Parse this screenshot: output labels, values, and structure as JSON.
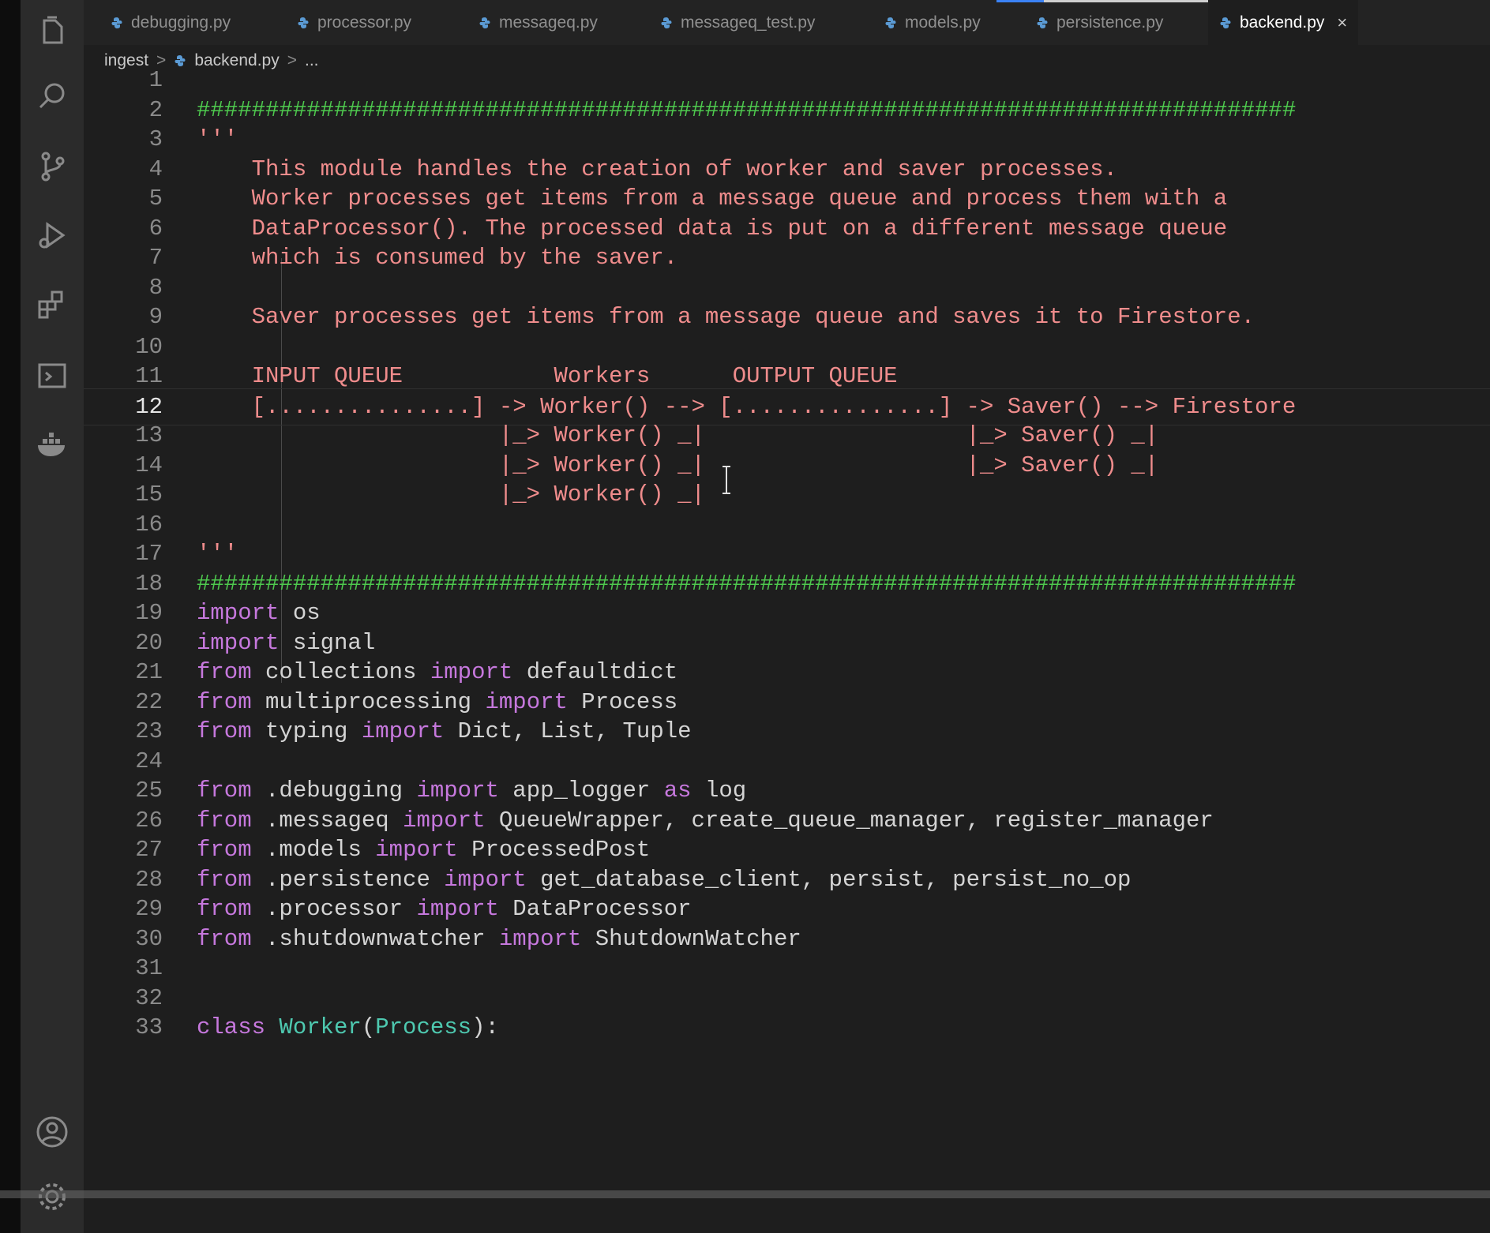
{
  "tabs": [
    {
      "label": "debugging.py",
      "active": false
    },
    {
      "label": "processor.py",
      "active": false
    },
    {
      "label": "messageq.py",
      "active": false
    },
    {
      "label": "messageq_test.py",
      "active": false
    },
    {
      "label": "models.py",
      "active": false
    },
    {
      "label": "persistence.py",
      "active": false
    },
    {
      "label": "backend.py",
      "active": true
    }
  ],
  "tab_close_glyph": "×",
  "breadcrumb": {
    "folder": "ingest",
    "file": "backend.py",
    "more": "...",
    "sep": ">"
  },
  "activity_icons": [
    "explorer-icon",
    "search-icon",
    "source-control-icon",
    "run-debug-icon",
    "extensions-icon",
    "remote-explorer-icon",
    "docker-icon",
    "account-icon",
    "settings-gear-icon"
  ],
  "colors": {
    "keyword": "#c678dd",
    "docstring": "#ef8c8c",
    "comment": "#4ec94e",
    "text": "#d4d4d4"
  },
  "current_line": 12,
  "lines": [
    {
      "n": "1",
      "tokens": []
    },
    {
      "n": "2",
      "tokens": [
        {
          "t": "################################################################################",
          "c": "hash"
        }
      ]
    },
    {
      "n": "3",
      "tokens": [
        {
          "t": "'''",
          "c": "doc"
        }
      ]
    },
    {
      "n": "4",
      "tokens": [
        {
          "t": "    This module handles the creation of worker and saver processes.",
          "c": "doc"
        }
      ]
    },
    {
      "n": "5",
      "tokens": [
        {
          "t": "    Worker processes get items from a message queue and process them with a",
          "c": "doc"
        }
      ]
    },
    {
      "n": "6",
      "tokens": [
        {
          "t": "    DataProcessor(). The processed data is put on a different message queue",
          "c": "doc"
        }
      ]
    },
    {
      "n": "7",
      "tokens": [
        {
          "t": "    which is consumed by the saver.",
          "c": "doc"
        }
      ]
    },
    {
      "n": "8",
      "tokens": []
    },
    {
      "n": "9",
      "tokens": [
        {
          "t": "    Saver processes get items from a message queue and saves it to Firestore.",
          "c": "doc"
        }
      ]
    },
    {
      "n": "10",
      "tokens": []
    },
    {
      "n": "11",
      "tokens": [
        {
          "t": "    INPUT QUEUE           Workers      OUTPUT QUEUE",
          "c": "doc"
        }
      ]
    },
    {
      "n": "12",
      "tokens": [
        {
          "t": "    [...............] -> Worker() --> [...............] -> Saver() --> Firestore",
          "c": "doc"
        }
      ]
    },
    {
      "n": "13",
      "tokens": [
        {
          "t": "                      |_> Worker() _|                   |_> Saver() _|",
          "c": "doc"
        }
      ]
    },
    {
      "n": "14",
      "tokens": [
        {
          "t": "                      |_> Worker() _|                   |_> Saver() _|",
          "c": "doc"
        }
      ]
    },
    {
      "n": "15",
      "tokens": [
        {
          "t": "                      |_> Worker() _|",
          "c": "doc"
        }
      ]
    },
    {
      "n": "16",
      "tokens": []
    },
    {
      "n": "17",
      "tokens": [
        {
          "t": "'''",
          "c": "doc"
        }
      ]
    },
    {
      "n": "18",
      "tokens": [
        {
          "t": "################################################################################",
          "c": "hash"
        }
      ]
    },
    {
      "n": "19",
      "tokens": [
        {
          "t": "import",
          "c": "kw"
        },
        {
          "t": " os",
          "c": "id"
        }
      ]
    },
    {
      "n": "20",
      "tokens": [
        {
          "t": "import",
          "c": "kw"
        },
        {
          "t": " signal",
          "c": "id"
        }
      ]
    },
    {
      "n": "21",
      "tokens": [
        {
          "t": "from",
          "c": "kw"
        },
        {
          "t": " collections ",
          "c": "id"
        },
        {
          "t": "import",
          "c": "kw"
        },
        {
          "t": " defaultdict",
          "c": "id"
        }
      ]
    },
    {
      "n": "22",
      "tokens": [
        {
          "t": "from",
          "c": "kw"
        },
        {
          "t": " multiprocessing ",
          "c": "id"
        },
        {
          "t": "import",
          "c": "kw"
        },
        {
          "t": " Process",
          "c": "id"
        }
      ]
    },
    {
      "n": "23",
      "tokens": [
        {
          "t": "from",
          "c": "kw"
        },
        {
          "t": " typing ",
          "c": "id"
        },
        {
          "t": "import",
          "c": "kw"
        },
        {
          "t": " Dict, List, Tuple",
          "c": "id"
        }
      ]
    },
    {
      "n": "24",
      "tokens": []
    },
    {
      "n": "25",
      "tokens": [
        {
          "t": "from",
          "c": "kw"
        },
        {
          "t": " .debugging ",
          "c": "id"
        },
        {
          "t": "import",
          "c": "kw"
        },
        {
          "t": " app_logger ",
          "c": "id"
        },
        {
          "t": "as",
          "c": "kw"
        },
        {
          "t": " log",
          "c": "id"
        }
      ]
    },
    {
      "n": "26",
      "tokens": [
        {
          "t": "from",
          "c": "kw"
        },
        {
          "t": " .messageq ",
          "c": "id"
        },
        {
          "t": "import",
          "c": "kw"
        },
        {
          "t": " QueueWrapper, create_queue_manager, register_manager",
          "c": "id"
        }
      ]
    },
    {
      "n": "27",
      "tokens": [
        {
          "t": "from",
          "c": "kw"
        },
        {
          "t": " .models ",
          "c": "id"
        },
        {
          "t": "import",
          "c": "kw"
        },
        {
          "t": " ProcessedPost",
          "c": "id"
        }
      ]
    },
    {
      "n": "28",
      "tokens": [
        {
          "t": "from",
          "c": "kw"
        },
        {
          "t": " .persistence ",
          "c": "id"
        },
        {
          "t": "import",
          "c": "kw"
        },
        {
          "t": " get_database_client, persist, persist_no_op",
          "c": "id"
        }
      ]
    },
    {
      "n": "29",
      "tokens": [
        {
          "t": "from",
          "c": "kw"
        },
        {
          "t": " .processor ",
          "c": "id"
        },
        {
          "t": "import",
          "c": "kw"
        },
        {
          "t": " DataProcessor",
          "c": "id"
        }
      ]
    },
    {
      "n": "30",
      "tokens": [
        {
          "t": "from",
          "c": "kw"
        },
        {
          "t": " .shutdownwatcher ",
          "c": "id"
        },
        {
          "t": "import",
          "c": "kw"
        },
        {
          "t": " ShutdownWatcher",
          "c": "id"
        }
      ]
    },
    {
      "n": "31",
      "tokens": []
    },
    {
      "n": "32",
      "tokens": []
    },
    {
      "n": "33",
      "tokens": [
        {
          "t": "class",
          "c": "kw"
        },
        {
          "t": " ",
          "c": "id"
        },
        {
          "t": "Worker",
          "c": "cls"
        },
        {
          "t": "(",
          "c": "id"
        },
        {
          "t": "Process",
          "c": "cls"
        },
        {
          "t": "):",
          "c": "id"
        }
      ]
    }
  ]
}
